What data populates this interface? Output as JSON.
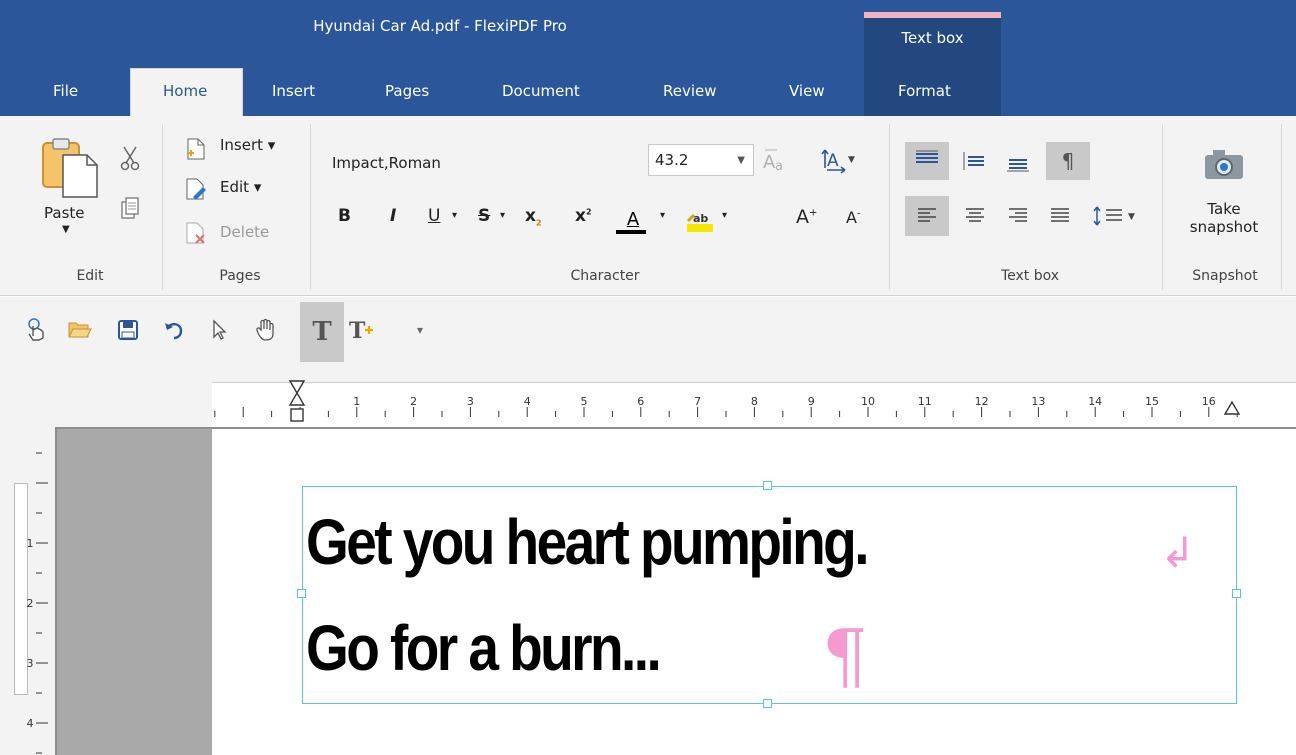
{
  "window": {
    "title": "Hyundai Car Ad.pdf - FlexiPDF Pro",
    "context_group": "Text box"
  },
  "tabs": [
    "File",
    "Home",
    "Insert",
    "Pages",
    "Document",
    "Review",
    "View",
    "Format"
  ],
  "ribbon": {
    "edit": {
      "paste": "Paste",
      "group": "Edit"
    },
    "pages": {
      "insert": "Insert",
      "edit": "Edit",
      "delete": "Delete",
      "group": "Pages"
    },
    "character": {
      "font_name": "Impact,Roman",
      "font_size": "43.2",
      "bold": "B",
      "italic": "I",
      "underline": "U",
      "strike": "S",
      "subscript": "x",
      "superscript": "x",
      "font_color_letter": "A",
      "grow": "A",
      "shrink": "A",
      "group": "Character"
    },
    "textbox": {
      "group": "Text box",
      "pilcrow": "¶"
    },
    "snapshot": {
      "take_line1": "Take",
      "take_line2": "snapshot",
      "group": "Snapshot"
    }
  },
  "ruler": {
    "h_numbers": [
      "1",
      "2",
      "3",
      "4",
      "5",
      "6",
      "7",
      "8",
      "9",
      "10",
      "11",
      "12",
      "13",
      "14",
      "15",
      "16"
    ],
    "v_numbers": [
      "1",
      "2",
      "3",
      "4"
    ]
  },
  "document": {
    "line1": "Get you heart pumping.",
    "line2": "Go for a burn..."
  },
  "colors": {
    "brand": "#2b579a",
    "context_tab": "#23487f",
    "context_accent": "#f4b3c2",
    "textbox_border": "#5bc3d6",
    "formatting_marks": "#f49ad0"
  }
}
